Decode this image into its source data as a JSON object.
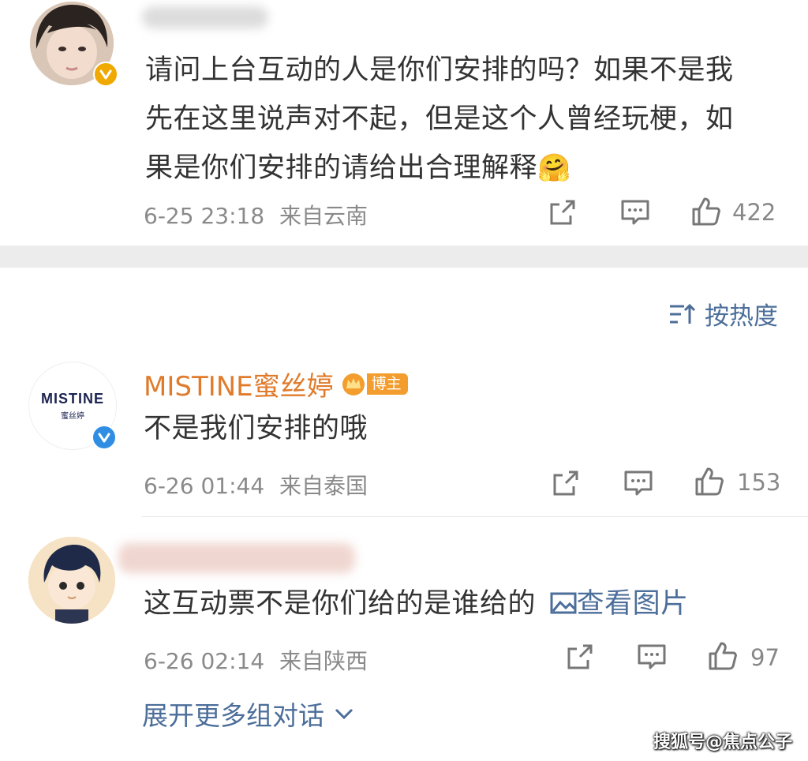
{
  "comments": [
    {
      "username": "",
      "text": "请问上台互动的人是你们安排的吗？如果不是我先在这里说声对不起，但是这个人曾经玩梗，如果是你们安排的请给出合理解释",
      "emoji": "🤗",
      "date": "6-25 23:18",
      "location": "来自云南",
      "likes": "422"
    },
    {
      "username": "MISTINE蜜丝婷",
      "badge": "博主",
      "avatar_text": "MISTINE",
      "avatar_subtext": "蜜丝婷",
      "text": "不是我们安排的哦",
      "date": "6-26 01:44",
      "location": "来自泰国",
      "likes": "153"
    },
    {
      "username": "",
      "text": "这互动票不是你们给的是谁给的",
      "link_text": "查看图片",
      "date": "6-26 02:14",
      "location": "来自陕西",
      "likes": "97"
    }
  ],
  "sort": {
    "label": "按热度"
  },
  "expand_more": {
    "label": "展开更多组对话"
  },
  "watermark": "搜狐号@焦点公子",
  "colors": {
    "link": "#4c6e9a",
    "author": "#e07b2c",
    "badge": "#f29d2d",
    "verified_gold": "#f0a900",
    "verified_blue": "#2f8de4"
  },
  "icons": [
    "verified-badge-icon",
    "share-icon",
    "comment-icon",
    "like-icon",
    "sort-icon",
    "crown-icon",
    "image-icon",
    "chevron-down-icon"
  ]
}
